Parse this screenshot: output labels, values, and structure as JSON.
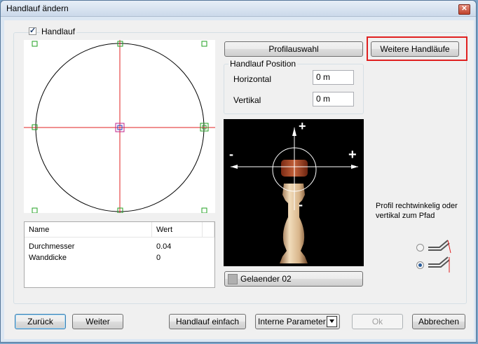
{
  "window": {
    "title": "Handlauf ändern",
    "close_glyph": "✕"
  },
  "handlauf_checkbox": {
    "label": "Handlauf",
    "checked": true
  },
  "buttons": {
    "profilauswahl": "Profilauswahl",
    "weitere": "Weitere Handläufe",
    "zurueck": "Zurück",
    "weiter": "Weiter",
    "einfach": "Handlauf einfach",
    "ok": "Ok",
    "abbrechen": "Abbrechen"
  },
  "position": {
    "group_label": "Handlauf Position",
    "horizontal_label": "Horizontal",
    "horizontal_value": "0 m",
    "vertikal_label": "Vertikal",
    "vertikal_value": "0 m"
  },
  "preview": {
    "plus_top": "+",
    "minus_left": "-",
    "plus_right": "+",
    "minus_bottom": "-"
  },
  "geländer_button": "Gelaender 02",
  "table": {
    "headers": [
      "Name",
      "Wert"
    ],
    "rows": [
      {
        "name": "Durchmesser",
        "value": "0.04"
      },
      {
        "name": "Wanddicke",
        "value": "0"
      }
    ]
  },
  "profil_text": "Profil rechtwinkelig oder vertikal zum Pfad",
  "dropdown": {
    "value": "Interne Parameter"
  },
  "colors": {
    "highlight": "#e02020",
    "axis": "#e02020",
    "handle": "#22a022",
    "preview_bg": "#000000"
  }
}
